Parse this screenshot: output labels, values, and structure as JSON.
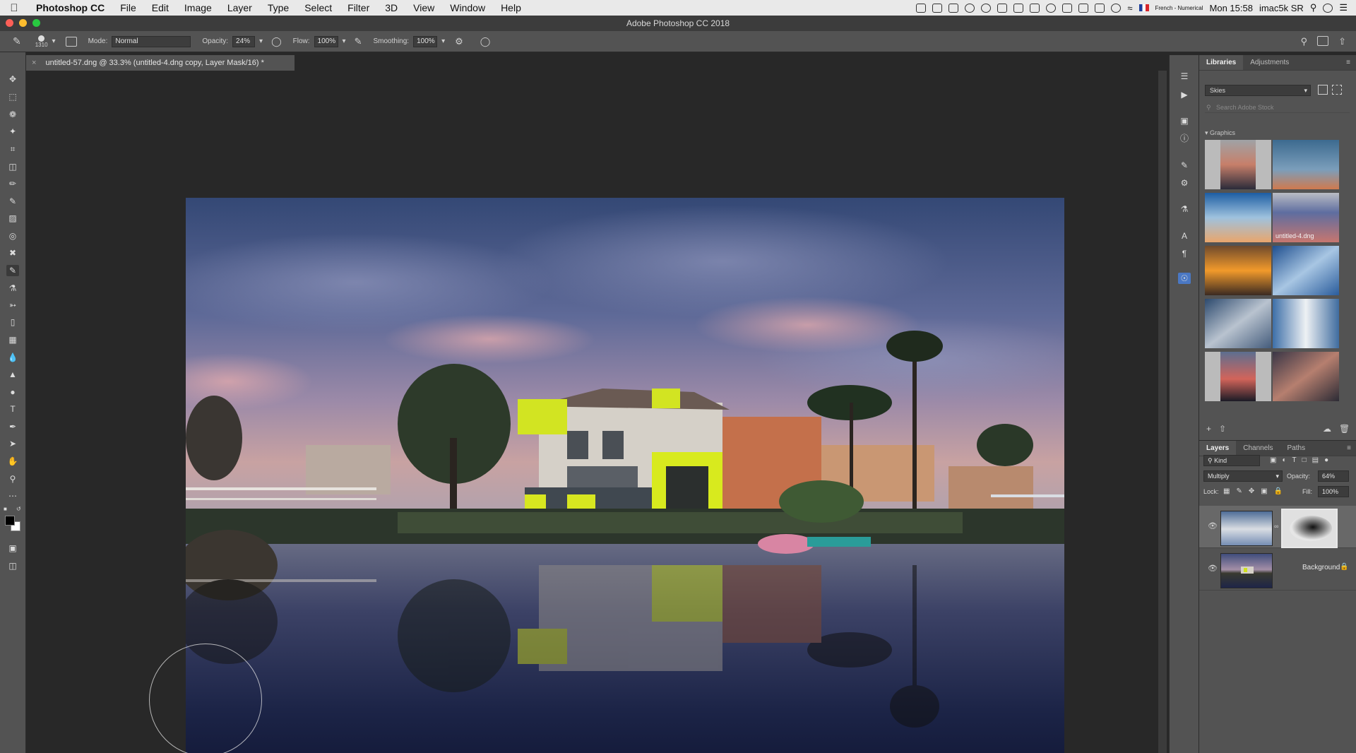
{
  "menubar": {
    "app": "Photoshop CC",
    "items": [
      "File",
      "Edit",
      "Image",
      "Layer",
      "Type",
      "Select",
      "Filter",
      "3D",
      "View",
      "Window",
      "Help"
    ],
    "input_source": "French - Numerical",
    "clock": "Mon 15:58",
    "machine": "imac5k SR"
  },
  "window": {
    "title": "Adobe Photoshop CC 2018"
  },
  "options": {
    "brush_size": "1310",
    "mode_label": "Mode:",
    "mode_value": "Normal",
    "opacity_label": "Opacity:",
    "opacity_value": "24%",
    "flow_label": "Flow:",
    "flow_value": "100%",
    "smoothing_label": "Smoothing:",
    "smoothing_value": "100%"
  },
  "document": {
    "tab_title": "untitled-57.dng @ 33.3% (untitled-4.dng copy, Layer Mask/16) *"
  },
  "libraries": {
    "tabs": [
      "Libraries",
      "Adjustments"
    ],
    "library_name": "Skies",
    "search_placeholder": "Search Adobe Stock",
    "section": "Graphics",
    "thumbnails": [
      {
        "name": "sky-sunset-pink",
        "caption": ""
      },
      {
        "name": "sky-blue-clouds",
        "caption": ""
      },
      {
        "name": "sky-bright-blue",
        "caption": ""
      },
      {
        "name": "sky-dusk",
        "caption": "untitled-4.dng"
      },
      {
        "name": "sky-orange-sunset",
        "caption": ""
      },
      {
        "name": "sky-cumulus-blue",
        "caption": ""
      },
      {
        "name": "sky-storm",
        "caption": ""
      },
      {
        "name": "sky-white-clouds",
        "caption": ""
      },
      {
        "name": "sky-red-horizon",
        "caption": ""
      },
      {
        "name": "sky-dramatic",
        "caption": ""
      }
    ]
  },
  "layers": {
    "tabs": [
      "Layers",
      "Channels",
      "Paths"
    ],
    "filter_value": "Kind",
    "blend_mode": "Multiply",
    "opacity_label": "Opacity:",
    "opacity_value": "64%",
    "lock_label": "Lock:",
    "fill_label": "Fill:",
    "fill_value": "100%",
    "items": [
      {
        "name": "",
        "has_mask": true,
        "visible": true
      },
      {
        "name": "Background",
        "has_mask": false,
        "visible": true,
        "locked": true
      }
    ]
  },
  "colors": {
    "app_bg": "#282828",
    "panel_bg": "#535353",
    "foreground_swatch": "#000000",
    "background_swatch": "#ffffff"
  }
}
